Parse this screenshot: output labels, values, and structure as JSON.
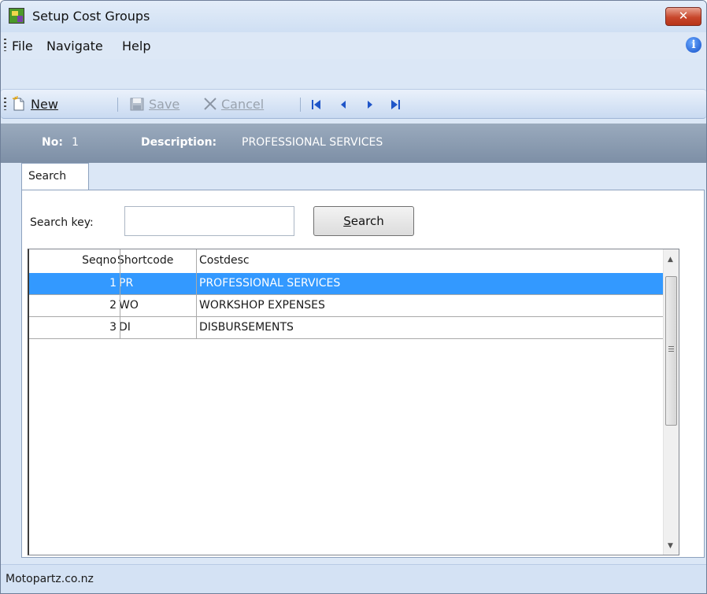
{
  "window": {
    "title": "Setup Cost Groups",
    "close_glyph": "✕"
  },
  "menu": {
    "items": [
      "File",
      "Navigate",
      "Help"
    ],
    "info_glyph": "i"
  },
  "toolbar": {
    "new_label": "New",
    "save_label": "Save",
    "cancel_label": "Cancel"
  },
  "record": {
    "no_label": "No:",
    "no_value": "1",
    "description_label": "Description:",
    "description_value": "PROFESSIONAL SERVICES"
  },
  "tabs": [
    {
      "label": "Search",
      "active": true
    }
  ],
  "search": {
    "key_label": "Search key:",
    "key_value": "",
    "button_label": "Search"
  },
  "grid": {
    "columns": [
      "Seqno",
      "Shortcode",
      "Costdesc"
    ],
    "rows": [
      {
        "seqno": "1",
        "shortcode": "PR",
        "costdesc": "PROFESSIONAL SERVICES",
        "selected": true
      },
      {
        "seqno": "2",
        "shortcode": "WO",
        "costdesc": "WORKSHOP EXPENSES",
        "selected": false
      },
      {
        "seqno": "3",
        "shortcode": "DI",
        "costdesc": "DISBURSEMENTS",
        "selected": false
      }
    ]
  },
  "status": {
    "text": "Motopartz.co.nz"
  },
  "colors": {
    "selection": "#3399ff",
    "infobar": "#8a9bb1",
    "close": "#c8472c"
  },
  "icons": [
    "app-icon",
    "close-icon",
    "info-icon",
    "new-document-icon",
    "save-disk-icon",
    "cancel-x-icon",
    "first-record-icon",
    "previous-record-icon",
    "next-record-icon",
    "last-record-icon"
  ]
}
